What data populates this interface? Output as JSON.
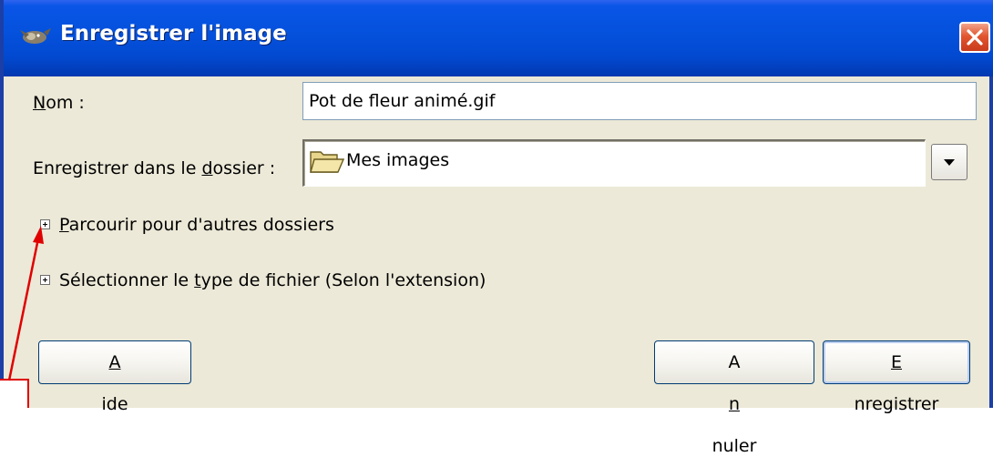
{
  "window": {
    "title": "Enregistrer l'image",
    "title_icon": "gimp-wilber-icon",
    "close_icon": "close-icon"
  },
  "form": {
    "name_label_u": "N",
    "name_label_rest": "om :",
    "name_value": "Pot de fleur animé.gif",
    "folder_label_pre": "Enregistrer dans le ",
    "folder_label_u": "d",
    "folder_label_post": "ossier :",
    "folder_value": "Mes images",
    "folder_icon": "folder-icon",
    "dropdown_icon": "chevron-down-icon"
  },
  "expanders": {
    "browse_u": "P",
    "browse_rest": "arcourir pour d'autres dossiers",
    "filetype_pre": "Sélectionner le ",
    "filetype_u": "t",
    "filetype_post": "ype de fichier (Selon l'extension)"
  },
  "buttons": {
    "help_u": "A",
    "help_rest": "ide",
    "cancel_pre": "A",
    "cancel_u": "n",
    "cancel_post": "nuler",
    "save_u": "E",
    "save_rest": "nregistrer"
  },
  "colors": {
    "title_bar": "#0552de",
    "dialog_bg": "#ece9d8",
    "annotation": "#e00000"
  }
}
